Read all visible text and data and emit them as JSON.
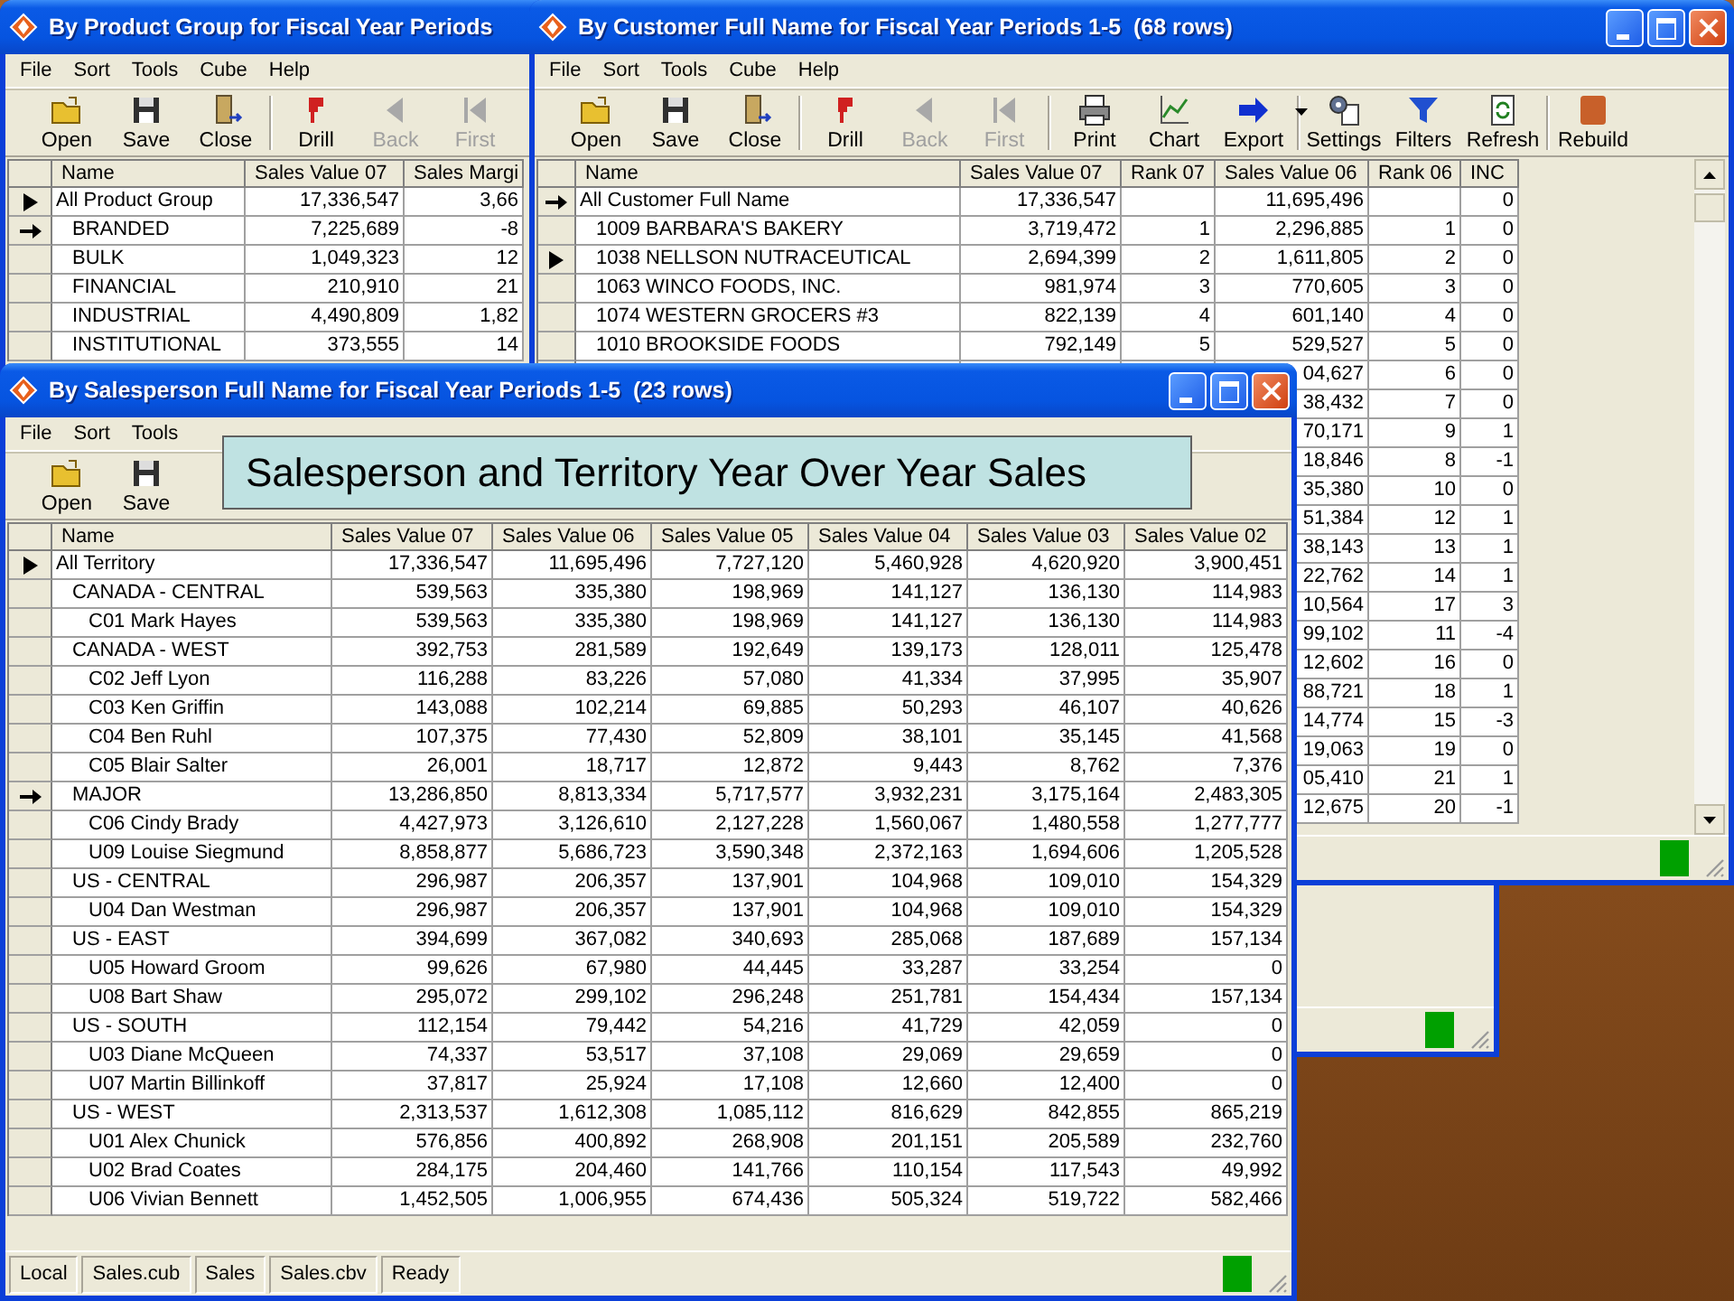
{
  "windows": [
    {
      "title": "By Product Group for Fiscal Year Periods",
      "controls": false,
      "menu": [
        "File",
        "Sort",
        "Tools",
        "Cube",
        "Help"
      ],
      "toolbar": [
        {
          "label": "Open",
          "kind": "open",
          "disabled": false
        },
        {
          "label": "Save",
          "kind": "save",
          "disabled": false
        },
        {
          "label": "Close",
          "kind": "close",
          "disabled": false
        },
        {
          "label": "Drill",
          "kind": "drill",
          "disabled": false,
          "group_start": true
        },
        {
          "label": "Back",
          "kind": "back",
          "disabled": true
        },
        {
          "label": "First",
          "kind": "first",
          "disabled": true
        }
      ],
      "table": {
        "columns": [
          "Name",
          "Sales Value 07",
          "Sales Margi"
        ],
        "rows": [
          {
            "name": "All Product Group",
            "values": [
              "17,336,547",
              "3,66"
            ],
            "selected": true,
            "bookmarked": false,
            "children": [
              {
                "name": "BRANDED",
                "values": [
                  "7,225,689",
                  "-8"
                ],
                "selected": false,
                "bookmarked": true
              },
              {
                "name": "BULK",
                "values": [
                  "1,049,323",
                  "12"
                ],
                "selected": false,
                "bookmarked": false
              },
              {
                "name": "FINANCIAL",
                "values": [
                  "210,910",
                  "21"
                ],
                "selected": false,
                "bookmarked": false
              },
              {
                "name": "INDUSTRIAL",
                "values": [
                  "4,490,809",
                  "1,82"
                ],
                "selected": false,
                "bookmarked": false
              },
              {
                "name": "INSTITUTIONAL",
                "values": [
                  "373,555",
                  "14"
                ],
                "selected": false,
                "bookmarked": false
              }
            ]
          }
        ]
      }
    },
    {
      "title": "By Customer Full Name for Fiscal Year Periods 1-5  (68 rows)",
      "controls": true,
      "menu": [
        "File",
        "Sort",
        "Tools",
        "Cube",
        "Help"
      ],
      "toolbar": [
        {
          "label": "Open",
          "kind": "open",
          "disabled": false
        },
        {
          "label": "Save",
          "kind": "save",
          "disabled": false
        },
        {
          "label": "Close",
          "kind": "close",
          "disabled": false
        },
        {
          "label": "Drill",
          "kind": "drill",
          "disabled": false,
          "group_start": true
        },
        {
          "label": "Back",
          "kind": "back",
          "disabled": true
        },
        {
          "label": "First",
          "kind": "first",
          "disabled": true
        },
        {
          "label": "Print",
          "kind": "print",
          "disabled": false,
          "group_start": true
        },
        {
          "label": "Chart",
          "kind": "chart",
          "disabled": false
        },
        {
          "label": "Export",
          "kind": "export",
          "disabled": false,
          "dropdown": true
        },
        {
          "label": "Settings",
          "kind": "settings",
          "disabled": false,
          "group_start": true
        },
        {
          "label": "Filters",
          "kind": "filters",
          "disabled": false
        },
        {
          "label": "Refresh",
          "kind": "refresh",
          "disabled": false
        },
        {
          "label": "Rebuild",
          "kind": "rebuild",
          "disabled": false,
          "group_start": true
        }
      ],
      "table": {
        "columns": [
          "Name",
          "Sales Value 07",
          "Rank 07",
          "Sales Value 06",
          "Rank 06",
          "INC"
        ],
        "rows": [
          {
            "name": "All Customer Full Name",
            "cells": {
              "1": "17,336,547",
              "3": "11,695,496",
              "5": "0"
            },
            "selected": false,
            "bookmarked": true,
            "children": [
              {
                "name": "1009 BARBARA'S BAKERY",
                "values": [
                  "3,719,472",
                  "1",
                  "2,296,885",
                  "1",
                  "0"
                ],
                "selected": false,
                "bookmarked": false
              },
              {
                "name": "1038 NELLSON NUTRACEUTICAL",
                "values": [
                  "2,694,399",
                  "2",
                  "1,611,805",
                  "2",
                  "0"
                ],
                "selected": true,
                "bookmarked": false
              },
              {
                "name": "1063 WINCO FOODS, INC.",
                "values": [
                  "981,974",
                  "3",
                  "770,605",
                  "3",
                  "0"
                ],
                "selected": false,
                "bookmarked": false
              },
              {
                "name": "1074 WESTERN GROCERS #3",
                "values": [
                  "822,139",
                  "4",
                  "601,140",
                  "4",
                  "0"
                ],
                "selected": false,
                "bookmarked": false
              },
              {
                "name": "1010 BROOKSIDE FOODS",
                "values": [
                  "792,149",
                  "5",
                  "529,527",
                  "5",
                  "0"
                ],
                "selected": false,
                "bookmarked": false
              }
            ]
          }
        ],
        "partial_rows": [
          [
            "04,627",
            "6",
            "0"
          ],
          [
            "38,432",
            "7",
            "0"
          ],
          [
            "70,171",
            "9",
            "1"
          ],
          [
            "18,846",
            "8",
            "-1"
          ],
          [
            "35,380",
            "10",
            "0"
          ],
          [
            "51,384",
            "12",
            "1"
          ],
          [
            "38,143",
            "13",
            "1"
          ],
          [
            "22,762",
            "14",
            "1"
          ],
          [
            "10,564",
            "17",
            "3"
          ],
          [
            "99,102",
            "11",
            "-4"
          ],
          [
            "12,602",
            "16",
            "0"
          ],
          [
            "88,721",
            "18",
            "1"
          ],
          [
            "14,774",
            "15",
            "-3"
          ],
          [
            "19,063",
            "19",
            "0"
          ],
          [
            "05,410",
            "21",
            "1"
          ],
          [
            "12,675",
            "20",
            "-1"
          ]
        ]
      }
    },
    {
      "title": "By Salesperson Full Name for Fiscal Year Periods 1-5  (23 rows)",
      "controls": true,
      "menu": [
        "File",
        "Sort",
        "Tools"
      ],
      "toolbar": [
        {
          "label": "Open",
          "kind": "open",
          "disabled": false
        },
        {
          "label": "Save",
          "kind": "save",
          "disabled": false
        }
      ],
      "tooltip": "Salesperson and Territory Year Over Year Sales",
      "table": {
        "columns": [
          "Name",
          "Sales Value 07",
          "Sales Value 06",
          "Sales Value 05",
          "Sales Value 04",
          "Sales Value 03",
          "Sales Value 02"
        ],
        "rows": [
          {
            "name": "All Territory",
            "values": [
              "17,336,547",
              "11,695,496",
              "7,727,120",
              "5,460,928",
              "4,620,920",
              "3,900,451"
            ],
            "selected": true,
            "bookmarked": false,
            "children": [
              {
                "name": "CANADA - CENTRAL",
                "values": [
                  "539,563",
                  "335,380",
                  "198,969",
                  "141,127",
                  "136,130",
                  "114,983"
                ],
                "selected": false,
                "bookmarked": false,
                "children": [
                  {
                    "name": "C01 Mark Hayes",
                    "values": [
                      "539,563",
                      "335,380",
                      "198,969",
                      "141,127",
                      "136,130",
                      "114,983"
                    ],
                    "selected": false,
                    "bookmarked": false
                  }
                ]
              },
              {
                "name": "CANADA - WEST",
                "values": [
                  "392,753",
                  "281,589",
                  "192,649",
                  "139,173",
                  "128,011",
                  "125,478"
                ],
                "selected": false,
                "bookmarked": false,
                "children": [
                  {
                    "name": "C02 Jeff Lyon",
                    "values": [
                      "116,288",
                      "83,226",
                      "57,080",
                      "41,334",
                      "37,995",
                      "35,907"
                    ],
                    "selected": false,
                    "bookmarked": false
                  },
                  {
                    "name": "C03 Ken Griffin",
                    "values": [
                      "143,088",
                      "102,214",
                      "69,885",
                      "50,293",
                      "46,107",
                      "40,626"
                    ],
                    "selected": false,
                    "bookmarked": false
                  },
                  {
                    "name": "C04 Ben Ruhl",
                    "values": [
                      "107,375",
                      "77,430",
                      "52,809",
                      "38,101",
                      "35,145",
                      "41,568"
                    ],
                    "selected": false,
                    "bookmarked": false
                  },
                  {
                    "name": "C05 Blair Salter",
                    "values": [
                      "26,001",
                      "18,717",
                      "12,872",
                      "9,443",
                      "8,762",
                      "7,376"
                    ],
                    "selected": false,
                    "bookmarked": false
                  }
                ]
              },
              {
                "name": "MAJOR",
                "values": [
                  "13,286,850",
                  "8,813,334",
                  "5,717,577",
                  "3,932,231",
                  "3,175,164",
                  "2,483,305"
                ],
                "selected": false,
                "bookmarked": true,
                "children": [
                  {
                    "name": "C06 Cindy Brady",
                    "values": [
                      "4,427,973",
                      "3,126,610",
                      "2,127,228",
                      "1,560,067",
                      "1,480,558",
                      "1,277,777"
                    ],
                    "selected": false,
                    "bookmarked": false
                  },
                  {
                    "name": "U09 Louise Siegmund",
                    "values": [
                      "8,858,877",
                      "5,686,723",
                      "3,590,348",
                      "2,372,163",
                      "1,694,606",
                      "1,205,528"
                    ],
                    "selected": false,
                    "bookmarked": false
                  }
                ]
              },
              {
                "name": "US - CENTRAL",
                "values": [
                  "296,987",
                  "206,357",
                  "137,901",
                  "104,968",
                  "109,010",
                  "154,329"
                ],
                "selected": false,
                "bookmarked": false,
                "children": [
                  {
                    "name": "U04 Dan Westman",
                    "values": [
                      "296,987",
                      "206,357",
                      "137,901",
                      "104,968",
                      "109,010",
                      "154,329"
                    ],
                    "selected": false,
                    "bookmarked": false
                  }
                ]
              },
              {
                "name": "US - EAST",
                "values": [
                  "394,699",
                  "367,082",
                  "340,693",
                  "285,068",
                  "187,689",
                  "157,134"
                ],
                "selected": false,
                "bookmarked": false,
                "children": [
                  {
                    "name": "U05 Howard Groom",
                    "values": [
                      "99,626",
                      "67,980",
                      "44,445",
                      "33,287",
                      "33,254",
                      "0"
                    ],
                    "selected": false,
                    "bookmarked": false
                  },
                  {
                    "name": "U08 Bart Shaw",
                    "values": [
                      "295,072",
                      "299,102",
                      "296,248",
                      "251,781",
                      "154,434",
                      "157,134"
                    ],
                    "selected": false,
                    "bookmarked": false
                  }
                ]
              },
              {
                "name": "US - SOUTH",
                "values": [
                  "112,154",
                  "79,442",
                  "54,216",
                  "41,729",
                  "42,059",
                  "0"
                ],
                "selected": false,
                "bookmarked": false,
                "children": [
                  {
                    "name": "U03 Diane McQueen",
                    "values": [
                      "74,337",
                      "53,517",
                      "37,108",
                      "29,069",
                      "29,659",
                      "0"
                    ],
                    "selected": false,
                    "bookmarked": false
                  },
                  {
                    "name": "U07 Martin Billinkoff",
                    "values": [
                      "37,817",
                      "25,924",
                      "17,108",
                      "12,660",
                      "12,400",
                      "0"
                    ],
                    "selected": false,
                    "bookmarked": false
                  }
                ]
              },
              {
                "name": "US - WEST",
                "values": [
                  "2,313,537",
                  "1,612,308",
                  "1,085,112",
                  "816,629",
                  "842,855",
                  "865,219"
                ],
                "selected": false,
                "bookmarked": false,
                "children": [
                  {
                    "name": "U01 Alex Chunick",
                    "values": [
                      "576,856",
                      "400,892",
                      "268,908",
                      "201,151",
                      "205,589",
                      "232,760"
                    ],
                    "selected": false,
                    "bookmarked": false
                  },
                  {
                    "name": "U02 Brad Coates",
                    "values": [
                      "284,175",
                      "204,460",
                      "141,766",
                      "110,154",
                      "117,543",
                      "49,992"
                    ],
                    "selected": false,
                    "bookmarked": false
                  },
                  {
                    "name": "U06 Vivian Bennett",
                    "values": [
                      "1,452,505",
                      "1,006,955",
                      "674,436",
                      "505,324",
                      "519,722",
                      "582,466"
                    ],
                    "selected": false,
                    "bookmarked": false
                  }
                ]
              }
            ]
          }
        ]
      },
      "status_bar": {
        "panels": [
          "Local",
          "Sales.cub",
          "Sales",
          "Sales.cbv",
          "Ready"
        ]
      }
    }
  ]
}
